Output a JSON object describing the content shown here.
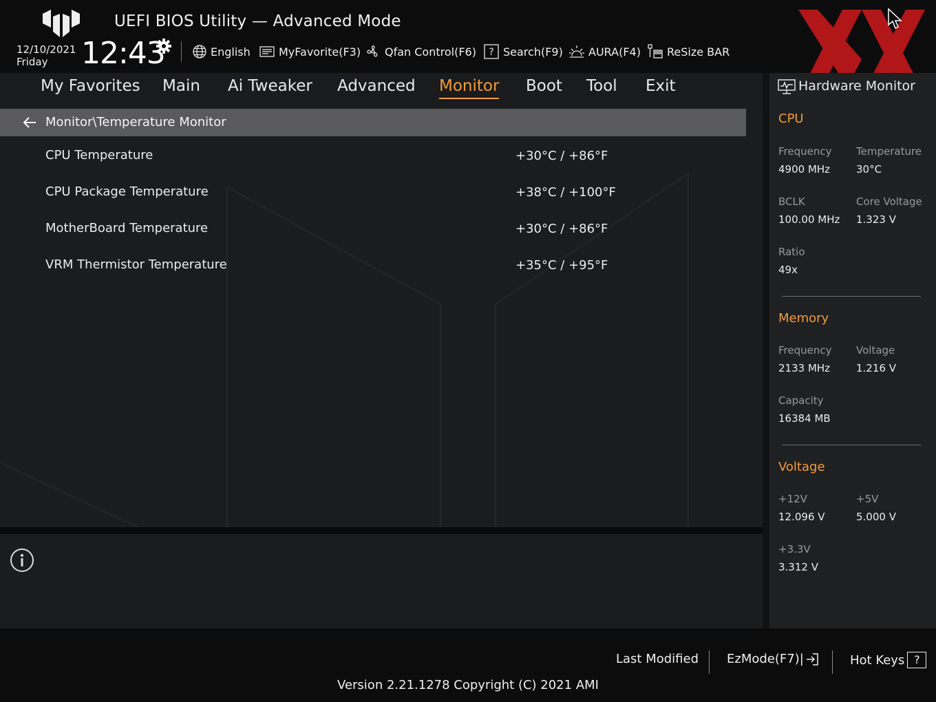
{
  "header": {
    "title": "UEFI BIOS Utility — Advanced Mode",
    "date": "12/10/2021",
    "weekday": "Friday",
    "time": "12:43",
    "items": [
      {
        "label": "English",
        "icon": "globe-icon"
      },
      {
        "label": "MyFavorite(F3)",
        "icon": "favorite-icon"
      },
      {
        "label": "Qfan Control(F6)",
        "icon": "fan-icon"
      },
      {
        "label": "Search(F9)",
        "icon": "search-help-icon"
      },
      {
        "label": "AURA(F4)",
        "icon": "aura-icon"
      },
      {
        "label": "ReSize BAR",
        "icon": "resize-bar-icon"
      }
    ]
  },
  "tabs": [
    {
      "label": "My Favorites"
    },
    {
      "label": "Main"
    },
    {
      "label": "Ai Tweaker"
    },
    {
      "label": "Advanced"
    },
    {
      "label": "Monitor",
      "active": true
    },
    {
      "label": "Boot"
    },
    {
      "label": "Tool"
    },
    {
      "label": "Exit"
    }
  ],
  "main": {
    "breadcrumb": "Monitor\\Temperature Monitor",
    "rows": [
      {
        "label": "CPU Temperature",
        "value": "+30°C / +86°F"
      },
      {
        "label": "CPU Package Temperature",
        "value": "+38°C / +100°F"
      },
      {
        "label": "MotherBoard Temperature",
        "value": "+30°C / +86°F"
      },
      {
        "label": "VRM Thermistor Temperature",
        "value": "+35°C / +95°F"
      }
    ]
  },
  "hardware_monitor": {
    "title": "Hardware Monitor",
    "cpu": {
      "heading": "CPU",
      "frequency_label": "Frequency",
      "frequency": "4900 MHz",
      "temperature_label": "Temperature",
      "temperature": "30°C",
      "bclk_label": "BCLK",
      "bclk": "100.00 MHz",
      "core_voltage_label": "Core Voltage",
      "core_voltage": "1.323 V",
      "ratio_label": "Ratio",
      "ratio": "49x"
    },
    "memory": {
      "heading": "Memory",
      "frequency_label": "Frequency",
      "frequency": "2133 MHz",
      "voltage_label": "Voltage",
      "voltage": "1.216 V",
      "capacity_label": "Capacity",
      "capacity": "16384 MB"
    },
    "voltage": {
      "heading": "Voltage",
      "v12_label": "+12V",
      "v12": "12.096 V",
      "v5_label": "+5V",
      "v5": "5.000 V",
      "v33_label": "+3.3V",
      "v33": "3.312 V"
    }
  },
  "footer": {
    "last_modified": "Last Modified",
    "ezmode": "EzMode(F7)|",
    "hotkeys": "Hot Keys",
    "hotkeys_key": "?",
    "version": "Version 2.21.1278 Copyright (C) 2021 AMI"
  },
  "colors": {
    "accent": "#f39c3a",
    "watermark": "#c0171b",
    "background": "#111214"
  }
}
